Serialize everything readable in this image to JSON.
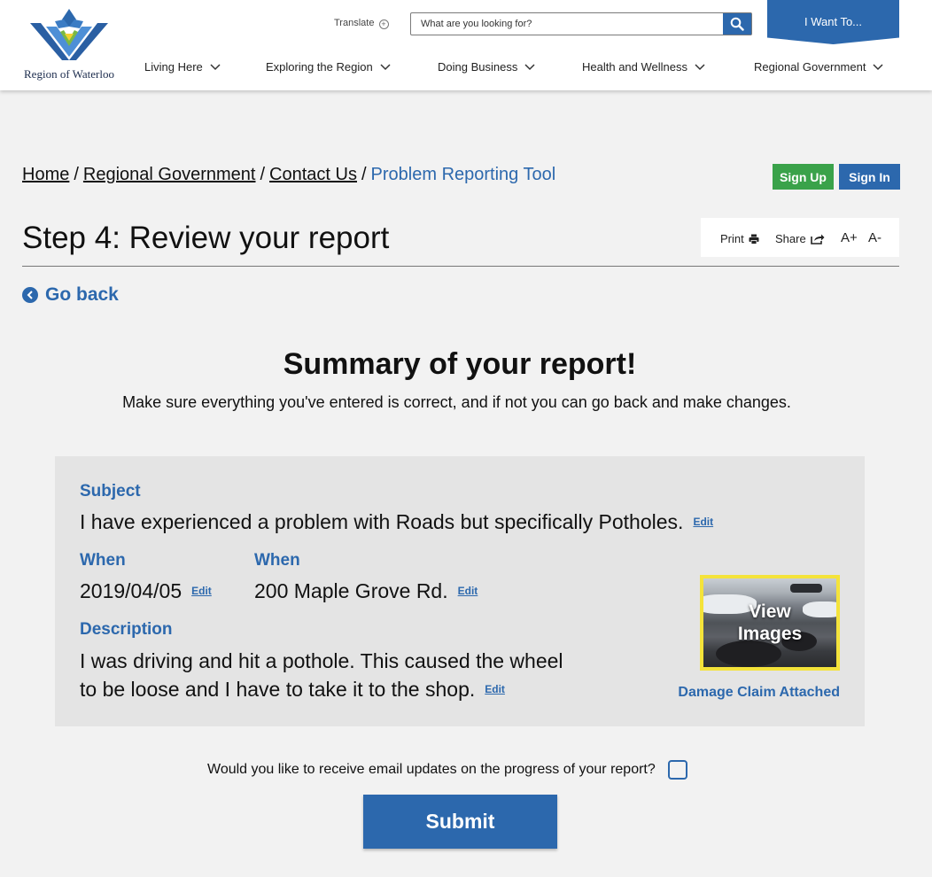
{
  "header": {
    "logo_text": "Region of Waterloo",
    "translate_label": "Translate",
    "search_placeholder": "What are you looking for?",
    "i_want_label": "I Want To...",
    "nav": [
      {
        "label": "Living Here"
      },
      {
        "label": "Exploring the Region"
      },
      {
        "label": "Doing Business"
      },
      {
        "label": "Health and Wellness"
      },
      {
        "label": "Regional Government"
      }
    ]
  },
  "breadcrumb": {
    "items": [
      "Home",
      "Regional Government",
      "Contact Us"
    ],
    "separator": "/",
    "current": "Problem Reporting Tool"
  },
  "auth": {
    "sign_up": "Sign Up",
    "sign_in": "Sign In"
  },
  "page": {
    "title": "Step 4: Review your report",
    "go_back": "Go back"
  },
  "tools": {
    "print": "Print",
    "share": "Share",
    "font_up": "A+",
    "font_down": "A-"
  },
  "summary": {
    "title": "Summary of your report!",
    "subtitle": "Make sure everything you've entered is correct, and if not you can go back and make changes."
  },
  "report": {
    "edit_label": "Edit",
    "subject_label": "Subject",
    "subject_value": "I have experienced a problem with Roads but specifically Potholes.",
    "date_label": "When",
    "date_value": "2019/04/05",
    "location_label": "When",
    "location_value": "200 Maple Grove Rd.",
    "description_label": "Description",
    "description_line1": "I was driving and hit a pothole. This caused the wheel",
    "description_line2": "to be loose and I have to take it to the shop.",
    "images_line1": "View",
    "images_line2": "Images",
    "attachment_label": "Damage Claim Attached"
  },
  "email_updates": {
    "label": "Would you like to receive email updates on the progress of your report?",
    "checked": false
  },
  "submit_label": "Submit",
  "colors": {
    "primary": "#2c68ad",
    "signup": "#3aa24a",
    "card": "#e4e4e4",
    "background": "#f2f2f2",
    "thumb_border": "#f4e33a"
  }
}
